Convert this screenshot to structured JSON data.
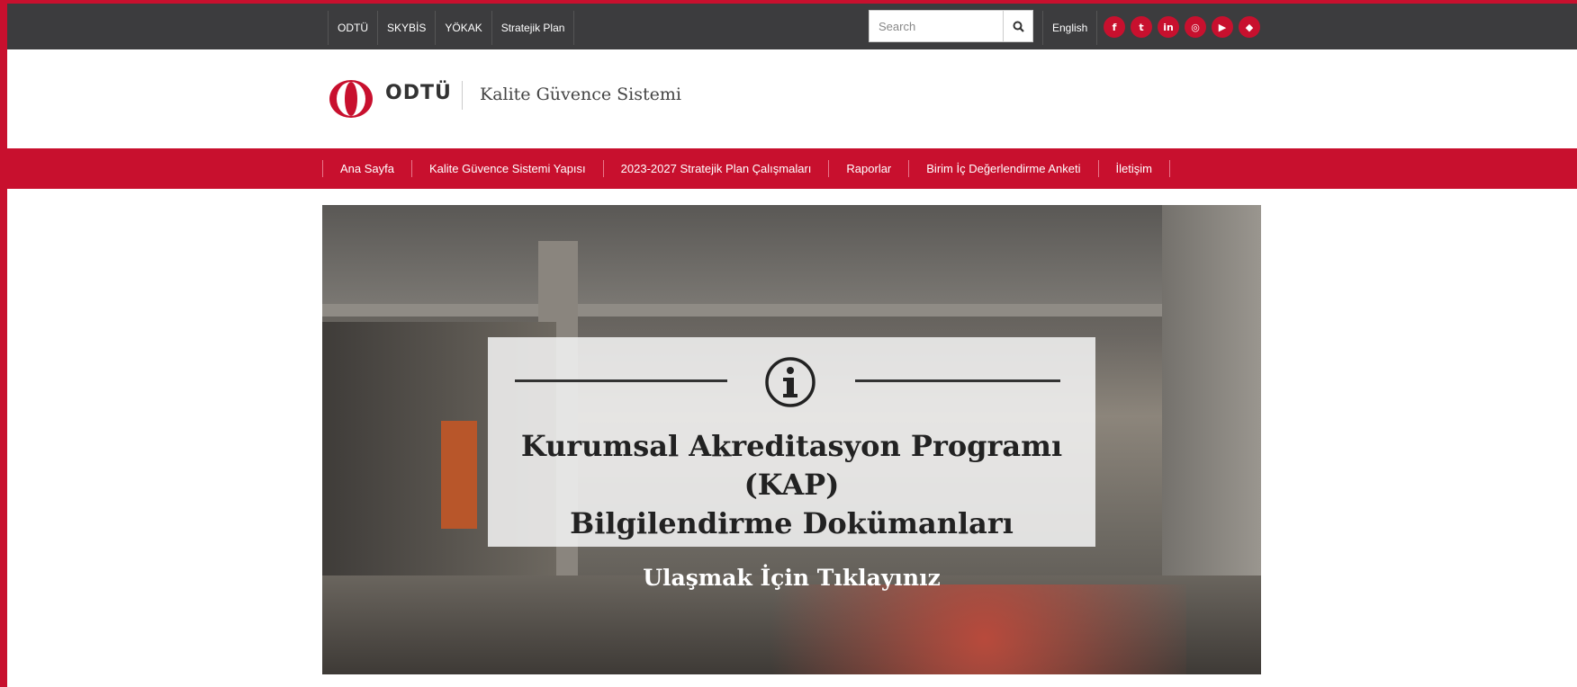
{
  "topbar": {
    "links": [
      "ODTÜ",
      "SKYBİS",
      "YÖKAK",
      "Stratejik Plan"
    ],
    "search_placeholder": "Search",
    "search_icon": "search-icon",
    "language": "English",
    "social": [
      {
        "icon": "facebook-icon",
        "glyph": "f"
      },
      {
        "icon": "twitter-icon",
        "glyph": "t"
      },
      {
        "icon": "linkedin-icon",
        "glyph": "in"
      },
      {
        "icon": "instagram-icon",
        "glyph": "◎"
      },
      {
        "icon": "youtube-icon",
        "glyph": "▶"
      },
      {
        "icon": "snapchat-icon",
        "glyph": "◆"
      }
    ]
  },
  "header": {
    "brand": "ODTÜ",
    "site_title": "Kalite Güvence Sistemi"
  },
  "nav": {
    "items": [
      "Ana Sayfa",
      "Kalite Güvence Sistemi Yapısı",
      "2023-2027 Stratejik Plan Çalışmaları",
      "Raporlar",
      "Birim İç Değerlendirme Anketi",
      "İletişim"
    ]
  },
  "hero": {
    "title_line1": "Kurumsal Akreditasyon Programı (KAP)",
    "title_line2": "Bilgilendirme Dokümanları",
    "cta": "Ulaşmak İçin Tıklayınız",
    "icon": "info-icon"
  },
  "colors": {
    "brand_red": "#c8102e",
    "topbar_bg": "#3c3c3e"
  }
}
